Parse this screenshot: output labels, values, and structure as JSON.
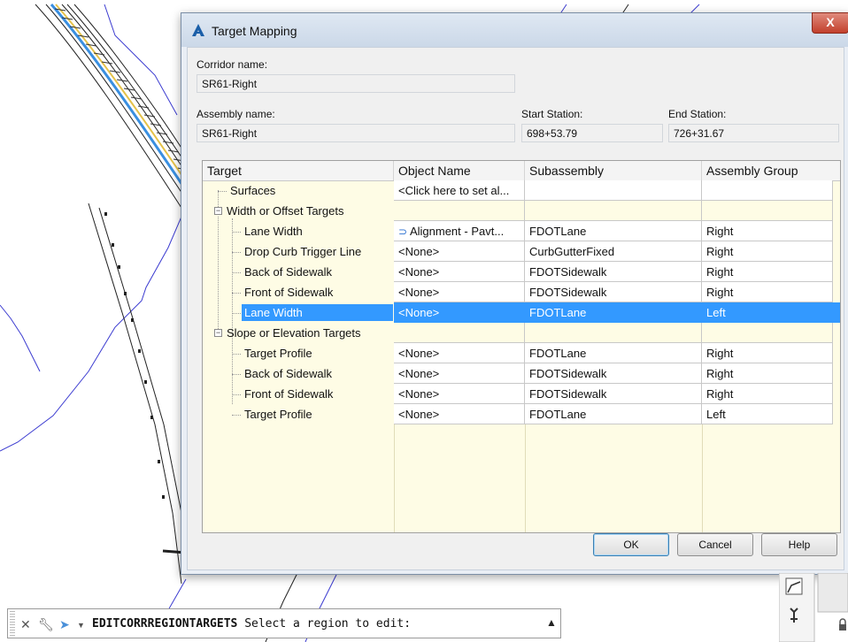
{
  "dialog": {
    "title": "Target Mapping",
    "close_glyph": "X",
    "corridor_label": "Corridor name:",
    "corridor_value": "SR61-Right",
    "assembly_label": "Assembly name:",
    "assembly_value": "SR61-Right",
    "start_label": "Start Station:",
    "start_value": "698+53.79",
    "end_label": "End Station:",
    "end_value": "726+31.67",
    "columns": [
      "Target",
      "Object Name",
      "Subassembly",
      "Assembly Group"
    ],
    "rows": [
      {
        "target": "Surfaces",
        "object": "<Click here to set al...",
        "sub": "",
        "group": ""
      },
      {
        "target": "Width or Offset Targets",
        "object": "",
        "sub": "",
        "group": ""
      },
      {
        "target": "Lane Width",
        "object": "Alignment - Pavt...",
        "sub": "FDOTLane",
        "group": "Right"
      },
      {
        "target": "Drop Curb Trigger Line",
        "object": "<None>",
        "sub": "CurbGutterFixed",
        "group": "Right"
      },
      {
        "target": "Back of Sidewalk",
        "object": "<None>",
        "sub": "FDOTSidewalk",
        "group": "Right"
      },
      {
        "target": "Front of Sidewalk",
        "object": "<None>",
        "sub": "FDOTSidewalk",
        "group": "Right"
      },
      {
        "target": "Lane Width",
        "object": "<None>",
        "sub": "FDOTLane",
        "group": "Left"
      },
      {
        "target": "Slope or Elevation Targets",
        "object": "",
        "sub": "",
        "group": ""
      },
      {
        "target": "Target Profile",
        "object": "<None>",
        "sub": "FDOTLane",
        "group": "Right"
      },
      {
        "target": "Back of Sidewalk",
        "object": "<None>",
        "sub": "FDOTSidewalk",
        "group": "Right"
      },
      {
        "target": "Front of Sidewalk",
        "object": "<None>",
        "sub": "FDOTSidewalk",
        "group": "Right"
      },
      {
        "target": "Target Profile",
        "object": "<None>",
        "sub": "FDOTLane",
        "group": "Left"
      }
    ],
    "buttons": {
      "ok": "OK",
      "cancel": "Cancel",
      "help": "Help"
    }
  },
  "command_line": {
    "command": "EDITCORRREGIONTARGETS",
    "prompt": "Select a region to edit:"
  },
  "colors": {
    "selection": "#3399ff",
    "grid_background": "#fefce5",
    "close_button": "#c2402c"
  }
}
